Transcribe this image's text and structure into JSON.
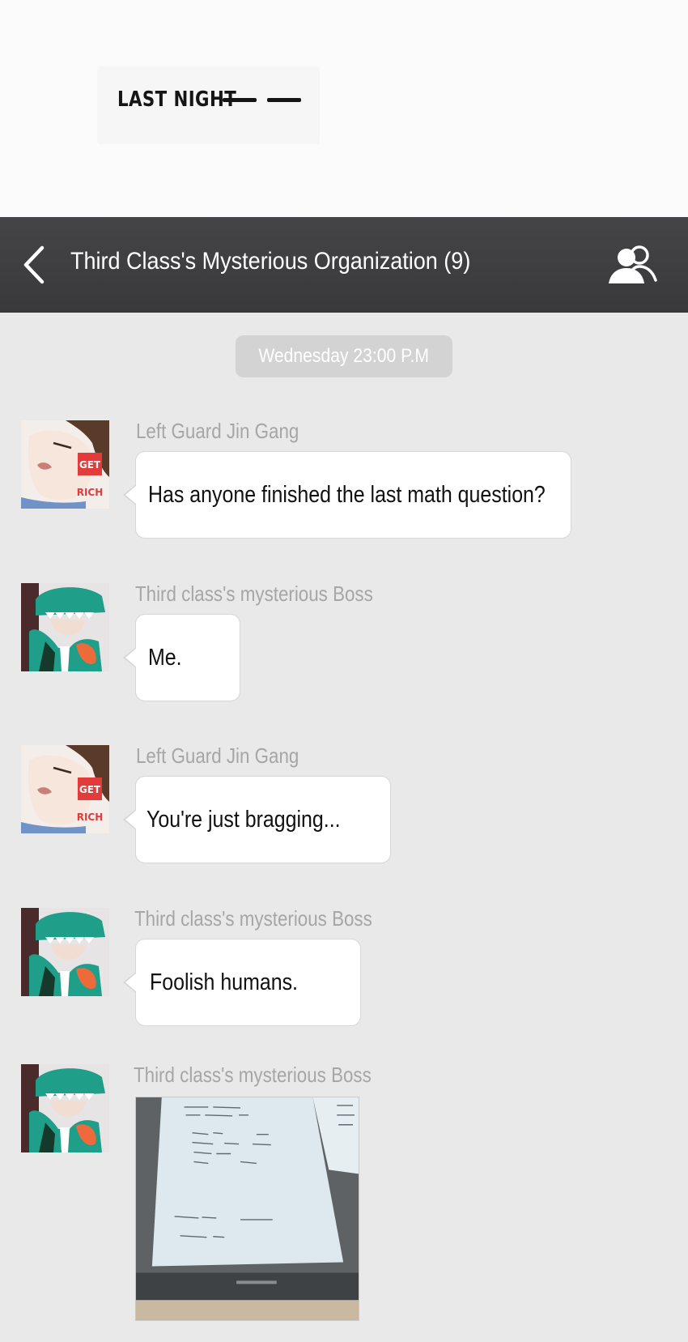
{
  "caption": {
    "text": "LAST NIGHT"
  },
  "header": {
    "back_icon": "chevron-left-icon",
    "title": "Third Class's Mysterious Organization (9)",
    "members_icon": "group-icon"
  },
  "chat": {
    "timestamp": "Wednesday 23:00 P.M",
    "messages": [
      {
        "sender": "Left Guard Jin Gang",
        "text": "Has anyone finished the last math question?",
        "avatar": "get-rich-avatar"
      },
      {
        "sender": "Third class's mysterious Boss",
        "text": "Me.",
        "avatar": "dinosaur-hood-avatar"
      },
      {
        "sender": "Left Guard Jin Gang",
        "text": "You're just bragging...",
        "avatar": "get-rich-avatar"
      },
      {
        "sender": "Third class's mysterious Boss",
        "text": "Foolish humans.",
        "avatar": "dinosaur-hood-avatar"
      },
      {
        "sender": "Third class's mysterious Boss",
        "avatar": "dinosaur-hood-avatar"
      }
    ],
    "avatar_sticker": {
      "line1": "GET",
      "line2": "RICH"
    }
  },
  "colors": {
    "header_bg": "#3f3f41",
    "chat_bg": "#e9e9e9",
    "bubble_bg": "#ffffff",
    "sender_text": "#a6a6a6",
    "timestamp_bg": "#d3d3d3",
    "sticker_red": "#e23b3b",
    "dino_teal": "#1f9e8a"
  }
}
